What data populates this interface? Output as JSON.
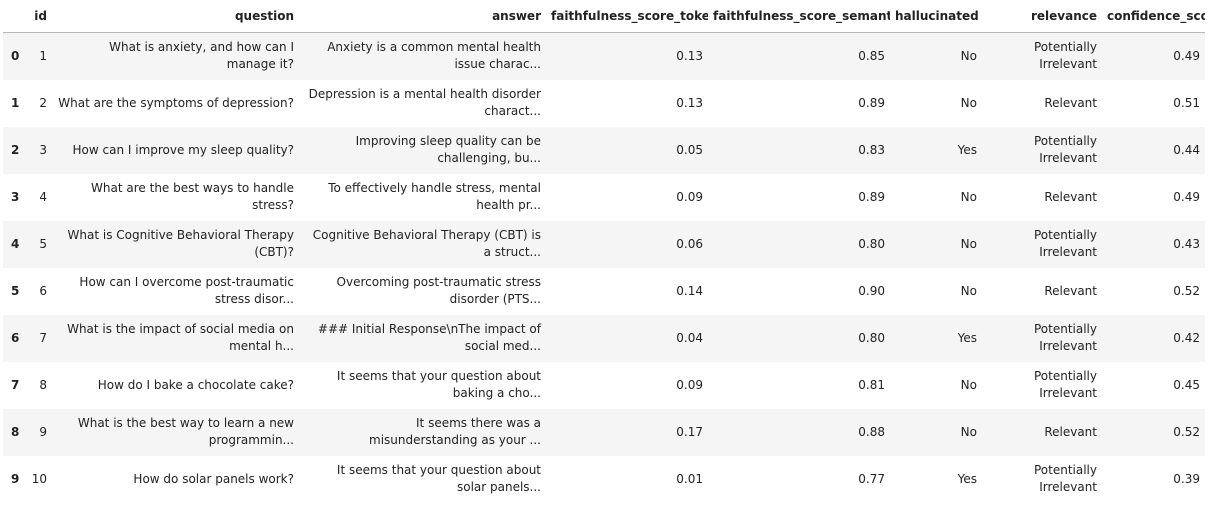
{
  "columns": {
    "index": "",
    "id": "id",
    "question": "question",
    "answer": "answer",
    "faithfulness_score_token": "faithfulness_score_token",
    "faithfulness_score_semantic": "faithfulness_score_semantic",
    "hallucinated": "hallucinated",
    "relevance": "relevance",
    "confidence_score": "confidence_score"
  },
  "rows": [
    {
      "index": "0",
      "id": "1",
      "question": "What is anxiety, and how can I manage it?",
      "answer": "Anxiety is a common mental health issue charac...",
      "faithfulness_score_token": "0.13",
      "faithfulness_score_semantic": "0.85",
      "hallucinated": "No",
      "relevance": "Potentially Irrelevant",
      "confidence_score": "0.49"
    },
    {
      "index": "1",
      "id": "2",
      "question": "What are the symptoms of depression?",
      "answer": "Depression is a mental health disorder charact...",
      "faithfulness_score_token": "0.13",
      "faithfulness_score_semantic": "0.89",
      "hallucinated": "No",
      "relevance": "Relevant",
      "confidence_score": "0.51"
    },
    {
      "index": "2",
      "id": "3",
      "question": "How can I improve my sleep quality?",
      "answer": "Improving sleep quality can be challenging, bu...",
      "faithfulness_score_token": "0.05",
      "faithfulness_score_semantic": "0.83",
      "hallucinated": "Yes",
      "relevance": "Potentially Irrelevant",
      "confidence_score": "0.44"
    },
    {
      "index": "3",
      "id": "4",
      "question": "What are the best ways to handle stress?",
      "answer": "To effectively handle stress, mental health pr...",
      "faithfulness_score_token": "0.09",
      "faithfulness_score_semantic": "0.89",
      "hallucinated": "No",
      "relevance": "Relevant",
      "confidence_score": "0.49"
    },
    {
      "index": "4",
      "id": "5",
      "question": "What is Cognitive Behavioral Therapy (CBT)?",
      "answer": "Cognitive Behavioral Therapy (CBT) is a struct...",
      "faithfulness_score_token": "0.06",
      "faithfulness_score_semantic": "0.80",
      "hallucinated": "No",
      "relevance": "Potentially Irrelevant",
      "confidence_score": "0.43"
    },
    {
      "index": "5",
      "id": "6",
      "question": "How can I overcome post-traumatic stress disor...",
      "answer": "Overcoming post-traumatic stress disorder (PTS...",
      "faithfulness_score_token": "0.14",
      "faithfulness_score_semantic": "0.90",
      "hallucinated": "No",
      "relevance": "Relevant",
      "confidence_score": "0.52"
    },
    {
      "index": "6",
      "id": "7",
      "question": "What is the impact of social media on mental h...",
      "answer": "### Initial Response\\nThe impact of social med...",
      "faithfulness_score_token": "0.04",
      "faithfulness_score_semantic": "0.80",
      "hallucinated": "Yes",
      "relevance": "Potentially Irrelevant",
      "confidence_score": "0.42"
    },
    {
      "index": "7",
      "id": "8",
      "question": "How do I bake a chocolate cake?",
      "answer": "It seems that your question about baking a cho...",
      "faithfulness_score_token": "0.09",
      "faithfulness_score_semantic": "0.81",
      "hallucinated": "No",
      "relevance": "Potentially Irrelevant",
      "confidence_score": "0.45"
    },
    {
      "index": "8",
      "id": "9",
      "question": "What is the best way to learn a new programmin...",
      "answer": "It seems there was a misunderstanding as your ...",
      "faithfulness_score_token": "0.17",
      "faithfulness_score_semantic": "0.88",
      "hallucinated": "No",
      "relevance": "Relevant",
      "confidence_score": "0.52"
    },
    {
      "index": "9",
      "id": "10",
      "question": "How do solar panels work?",
      "answer": "It seems that your question about solar panels...",
      "faithfulness_score_token": "0.01",
      "faithfulness_score_semantic": "0.77",
      "hallucinated": "Yes",
      "relevance": "Potentially Irrelevant",
      "confidence_score": "0.39"
    }
  ]
}
